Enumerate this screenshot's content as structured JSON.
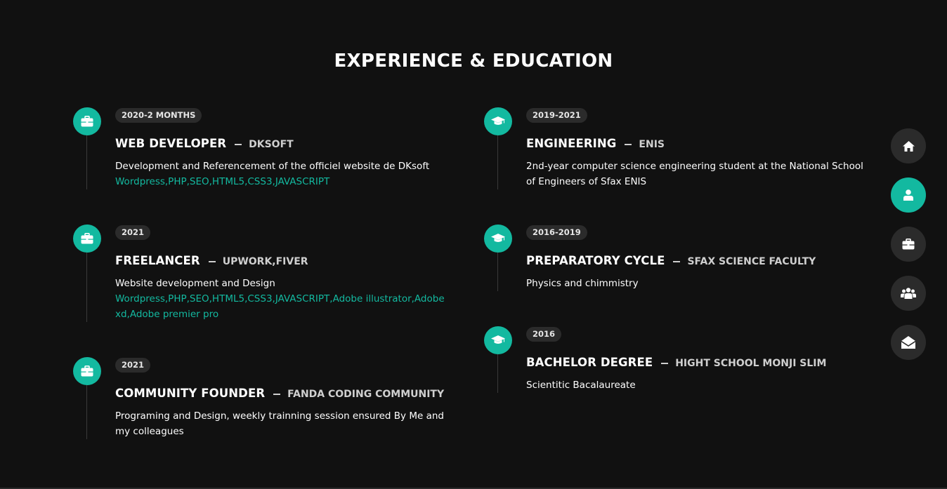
{
  "section": {
    "title": "EXPERIENCE & EDUCATION"
  },
  "experience": [
    {
      "year": "2020-2 MONTHS",
      "title": "WEB DEVELOPER",
      "place": "DKSOFT",
      "description": "Development and Referencement of the officiel website de DKsoft",
      "skills": "Wordpress,PHP,SEO,HTML5,CSS3,JAVASCRIPT",
      "icon": "briefcase-icon"
    },
    {
      "year": "2021",
      "title": "FREELANCER",
      "place": "UPWORK,FIVER",
      "description": "Website development and Design",
      "skills": "Wordpress,PHP,SEO,HTML5,CSS3,JAVASCRIPT,Adobe illustrator,Adobe xd,Adobe premier pro",
      "icon": "briefcase-icon"
    },
    {
      "year": "2021",
      "title": "COMMUNITY FOUNDER",
      "place": "FANDA CODING COMMUNITY",
      "description": "Programing and Design, weekly trainning session ensured By Me and my colleagues",
      "icon": "briefcase-icon"
    }
  ],
  "education": [
    {
      "year": "2019-2021",
      "title": "ENGINEERING",
      "place": "ENIS",
      "description": "2nd-year computer science engineering student at the National School of Engineers of Sfax ENIS",
      "icon": "graduation-cap-icon"
    },
    {
      "year": "2016-2019",
      "title": "PREPARATORY CYCLE",
      "place": "SFAX SCIENCE FACULTY",
      "description": "Physics and chimmistry",
      "icon": "graduation-cap-icon"
    },
    {
      "year": "2016",
      "title": "BACHELOR DEGREE",
      "place": "HIGHT SCHOOL MONJI SLIM",
      "description": "Scientitic Bacalaureate",
      "icon": "graduation-cap-icon"
    }
  ],
  "side_nav": [
    {
      "icon": "home-icon",
      "active": false
    },
    {
      "icon": "user-icon",
      "active": true
    },
    {
      "icon": "briefcase-icon",
      "active": false
    },
    {
      "icon": "users-icon",
      "active": false
    },
    {
      "icon": "envelope-open-icon",
      "active": false
    }
  ],
  "colors": {
    "accent": "#13b9a0",
    "background": "#111111",
    "chip": "#2b2b2b"
  }
}
